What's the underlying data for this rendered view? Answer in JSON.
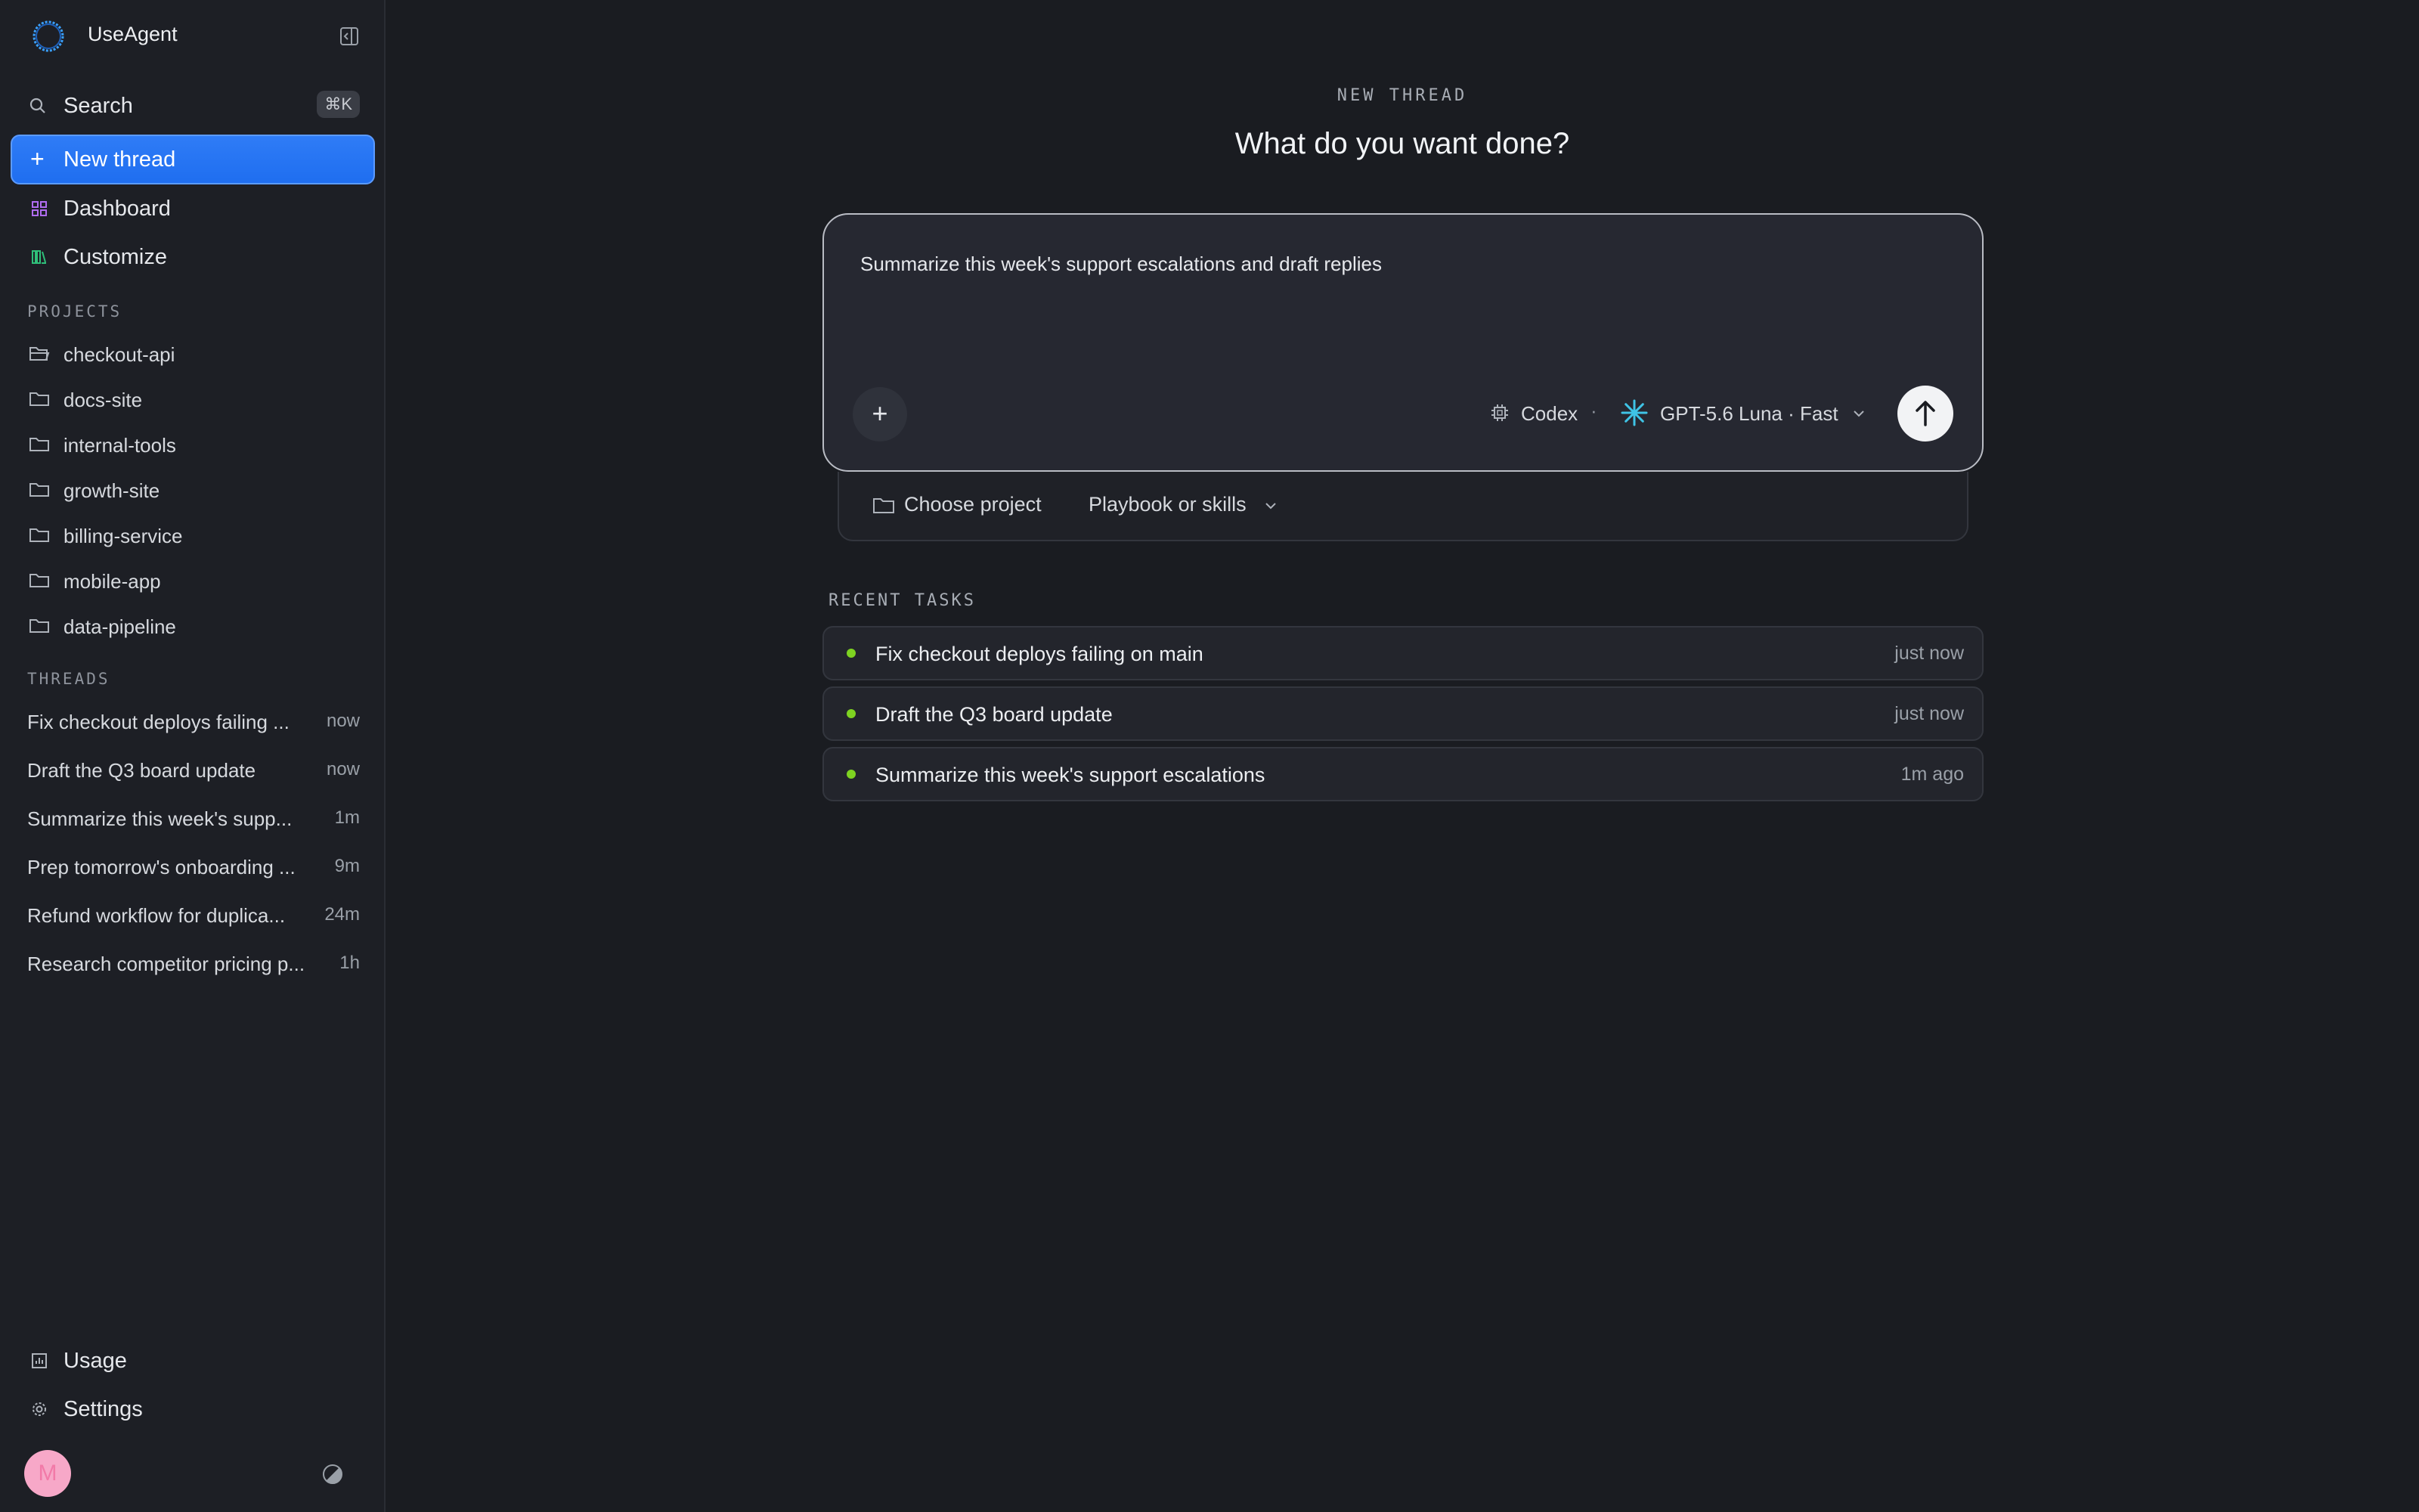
{
  "app": {
    "title": "UseAgent"
  },
  "sidebar": {
    "search": {
      "label": "Search",
      "shortcut": "⌘K"
    },
    "new_thread": "New thread",
    "nav": [
      {
        "label": "Dashboard",
        "icon": "grid-icon"
      },
      {
        "label": "Customize",
        "icon": "library-icon"
      }
    ],
    "projects_label": "PROJECTS",
    "projects": [
      "checkout-api",
      "docs-site",
      "internal-tools",
      "growth-site",
      "billing-service",
      "mobile-app",
      "data-pipeline"
    ],
    "threads_label": "THREADS",
    "threads": [
      {
        "title": "Fix checkout deploys failing ...",
        "time": "now"
      },
      {
        "title": "Draft the Q3 board update",
        "time": "now"
      },
      {
        "title": "Summarize this week's supp...",
        "time": "1m"
      },
      {
        "title": "Prep tomorrow's onboarding ...",
        "time": "9m"
      },
      {
        "title": "Refund workflow for duplica...",
        "time": "24m"
      },
      {
        "title": "Research competitor pricing p...",
        "time": "1h"
      }
    ],
    "footer": [
      {
        "label": "Usage",
        "icon": "chart-icon"
      },
      {
        "label": "Settings",
        "icon": "gear-icon"
      }
    ],
    "avatar_initial": "M"
  },
  "main": {
    "eyebrow": "NEW THREAD",
    "headline": "What do you want done?",
    "composer": {
      "text": "Summarize this week's support escalations and draft replies",
      "agent": "Codex",
      "separator": "·",
      "model": "GPT-5.6 Luna · Fast"
    },
    "subbar": {
      "project": "Choose project",
      "skills": "Playbook or skills"
    },
    "recent_label": "RECENT TASKS",
    "recent_tasks": [
      {
        "title": "Fix checkout deploys failing on main",
        "time": "just now"
      },
      {
        "title": "Draft the Q3 board update",
        "time": "just now"
      },
      {
        "title": "Summarize this week's support escalations",
        "time": "1m ago"
      }
    ]
  },
  "colors": {
    "accent": "#2f7cf6",
    "status_dot": "#7ed321",
    "background": "#1a1c21",
    "sidebar": "#1d1f25"
  }
}
